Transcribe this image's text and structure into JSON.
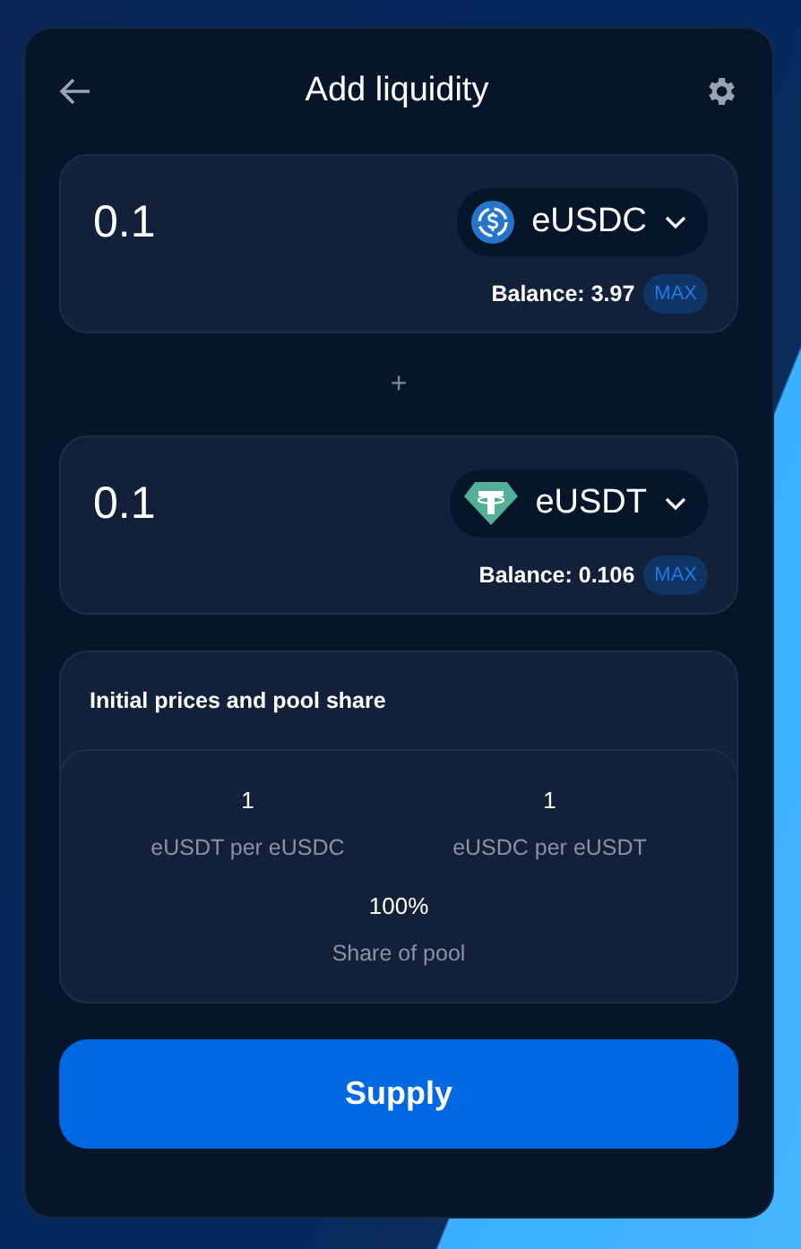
{
  "header": {
    "title": "Add liquidity"
  },
  "inputs": [
    {
      "amount": "0.1",
      "token": {
        "symbol": "eUSDC",
        "kind": "usdc"
      },
      "balance": "Balance: 3.97",
      "max": "MAX"
    },
    {
      "amount": "0.1",
      "token": {
        "symbol": "eUSDT",
        "kind": "usdt"
      },
      "balance": "Balance: 0.106",
      "max": "MAX"
    }
  ],
  "separator": "+",
  "prices": {
    "title": "Initial prices and pool share",
    "items": [
      {
        "value": "1",
        "label": "eUSDT per eUSDC"
      },
      {
        "value": "1",
        "label": "eUSDC per eUSDT"
      },
      {
        "value": "100%",
        "label": "Share of pool"
      }
    ]
  },
  "action": {
    "label": "Supply"
  }
}
